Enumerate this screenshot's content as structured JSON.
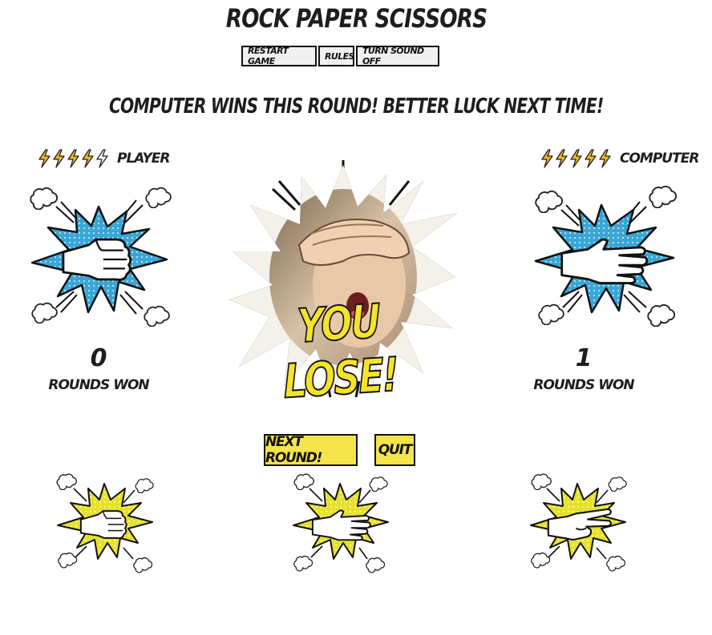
{
  "header": {
    "title": "Rock Paper Scissors"
  },
  "toolbar": {
    "restart_label": "Restart Game",
    "rules_label": "Rules",
    "sound_label": "Turn Sound Off"
  },
  "round": {
    "message": "Computer wins this round! Better luck next time!"
  },
  "player": {
    "name": "Player",
    "lives_total": 5,
    "lives_remaining": 4,
    "score": "0",
    "score_label": "Rounds won",
    "pick": "rock"
  },
  "computer": {
    "name": "Computer",
    "lives_total": 5,
    "lives_remaining": 5,
    "score": "1",
    "score_label": "Rounds won",
    "pick": "paper"
  },
  "outcome": {
    "banner": "You Lose!"
  },
  "actions": {
    "next_label": "Next Round!",
    "quit_label": "Quit"
  },
  "choices": [
    "rock",
    "paper",
    "scissors"
  ],
  "colors": {
    "bolt_full": "#f2b824",
    "bolt_empty": "#ffffff",
    "burst_blue": "#3aa6d6",
    "burst_yellow": "#e8e33a",
    "button_yellow": "#f5e44a"
  }
}
